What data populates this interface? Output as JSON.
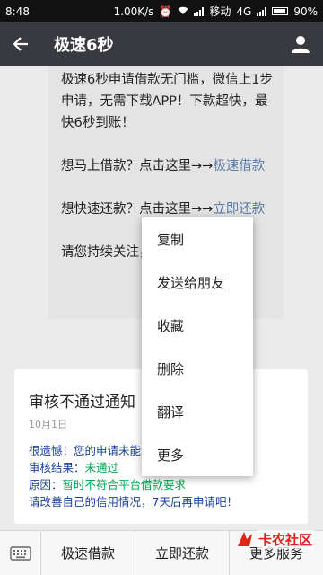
{
  "status_bar": {
    "time": "8:48",
    "speed": "1.00K/s",
    "carrier": "移动",
    "network": "4G",
    "battery": "90%",
    "battery_level": 0.9
  },
  "header": {
    "title": "极速6秒",
    "back_icon": "arrow-left-icon",
    "profile_icon": "person-icon"
  },
  "message": {
    "para1": "极速6秒申请借款无门槛，微信上1步申请，无需下载APP！下款超快，最快6秒到账！",
    "para2_text": "想马上借款？点击这里→→",
    "para2_link": "极速借款",
    "para3_text": "想快速还款？点击这里→→",
    "para3_link": "立即还款",
    "para4": "请您持续关注，第一时间掌控！"
  },
  "notice_card": {
    "title": "审核不通过通知",
    "date": "10月1日",
    "line1": "很遗憾！您的申请未能",
    "result_label": "审核结果：",
    "result_value": "未通过",
    "reason_label": "原因：",
    "reason_value": "暂时不符合平台借款要求",
    "line4": "请改善自己的信用情况，7天后再申请吧！"
  },
  "context_menu": {
    "items": [
      "复制",
      "发送给朋友",
      "收藏",
      "删除",
      "翻译",
      "更多"
    ]
  },
  "bottom_bar": {
    "keyboard_icon": "keyboard-icon",
    "tabs": [
      "极速借款",
      "立即还款",
      "更多服务"
    ]
  },
  "watermark": {
    "text": "卡农社区"
  },
  "colors": {
    "app_bar": "#393a3f",
    "link": "#5d7ca6",
    "notice_text": "#1a3f9c",
    "result_green": "#00a651",
    "watermark_red": "#e0241c"
  }
}
